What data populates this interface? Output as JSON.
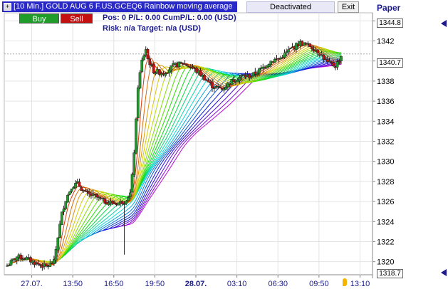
{
  "header": {
    "plus": "+",
    "title": "[10 Min.] GOLD AUG 6   F.US.GCEQ6 Rainbow moving average"
  },
  "buttons": {
    "buy": "Buy",
    "sell": "Sell",
    "deactivated": "Deactivated",
    "exit": "Exit"
  },
  "info": {
    "line1": "Pos: 0  P/L: 0.00  CumP/L: 0.00 (USD)",
    "line2": "Risk: n/a  Target: n/a (USD)"
  },
  "account": "Paper",
  "price_tags": {
    "top": "1344.8",
    "current": "1340.7",
    "bottom": "1318.7"
  },
  "colors": {
    "up": "#1f9c2a",
    "down": "#c31111",
    "title_bg": "#2929c8",
    "text": "#1a1a8c"
  },
  "chart_data": {
    "type": "candlestick",
    "ylim": [
      1318.7,
      1344.8
    ],
    "yticks": [
      1320,
      1322,
      1324,
      1326,
      1328,
      1330,
      1332,
      1334,
      1336,
      1338,
      1340,
      1342,
      1344
    ],
    "xticks": [
      "27.07.",
      "13:50",
      "16:50",
      "19:50",
      "28.07.",
      "03:10",
      "06:30",
      "09:50",
      "13:10"
    ],
    "xtick_bold": [
      false,
      false,
      false,
      false,
      true,
      false,
      false,
      false,
      false
    ],
    "grid": true,
    "current_price": 1340.7,
    "anchors": [
      [
        0,
        1319.6
      ],
      [
        5,
        1320.5
      ],
      [
        10,
        1320.3
      ],
      [
        15,
        1319.8
      ],
      [
        20,
        1319.5
      ],
      [
        24,
        1320.0
      ],
      [
        26,
        1322.5
      ],
      [
        28,
        1324.8
      ],
      [
        30,
        1326.2
      ],
      [
        33,
        1327.5
      ],
      [
        36,
        1327.8
      ],
      [
        40,
        1326.8
      ],
      [
        45,
        1326.5
      ],
      [
        50,
        1326.0
      ],
      [
        55,
        1325.8
      ],
      [
        60,
        1326.0
      ],
      [
        63,
        1326.8
      ],
      [
        64,
        1328.5
      ],
      [
        65,
        1331.0
      ],
      [
        66,
        1334.0
      ],
      [
        67,
        1337.5
      ],
      [
        69,
        1340.0
      ],
      [
        71,
        1341.2
      ],
      [
        72,
        1340.2
      ],
      [
        75,
        1339.0
      ],
      [
        80,
        1338.8
      ],
      [
        85,
        1339.5
      ],
      [
        90,
        1339.8
      ],
      [
        95,
        1339.3
      ],
      [
        100,
        1338.5
      ],
      [
        105,
        1337.5
      ],
      [
        110,
        1337.2
      ],
      [
        115,
        1338.0
      ],
      [
        120,
        1338.5
      ],
      [
        125,
        1338.5
      ],
      [
        130,
        1339.2
      ],
      [
        135,
        1340.0
      ],
      [
        140,
        1340.3
      ],
      [
        145,
        1341.2
      ],
      [
        150,
        1341.8
      ],
      [
        155,
        1341.5
      ],
      [
        160,
        1340.8
      ],
      [
        164,
        1339.8
      ],
      [
        168,
        1339.5
      ],
      [
        171,
        1340.5
      ]
    ]
  }
}
